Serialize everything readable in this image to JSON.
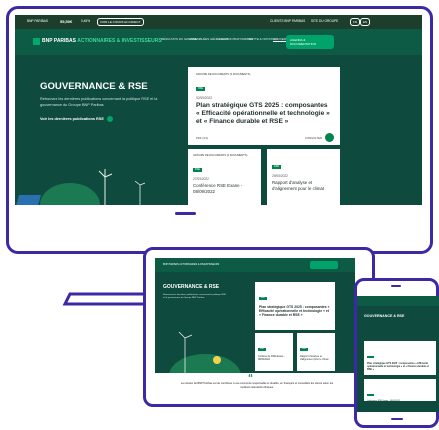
{
  "colors": {
    "frame": "#3b2aa3",
    "screen_bg": "#0e4a3d",
    "nav_bg": "#0d5a45",
    "accent_green": "#00a36a",
    "badge_green": "#00844f"
  },
  "desktop": {
    "top_strip": {
      "market_label": "BNP PARIBAS",
      "price": "55,50€",
      "change": "0,48%",
      "strip_link": "VOIR LE COURS EN DIRECT",
      "right_links": [
        "CLIENTS BNP PARIBAS",
        "SITE DU GROUPE",
        "FR",
        "EN"
      ]
    },
    "navbar": {
      "brand": "BNP PARIBAS",
      "brand_accent": "ACTIONNAIRES & INVESTISSEURS",
      "items": [
        "RÉSULTATS DU GROUPE",
        "ASSEMBLÉES GÉNÉRALES",
        "L'ACTION BNP PARIBAS",
        "DETTE & NOTATION",
        "GOUVERNANCE & RSE"
      ],
      "cta": "AGENDA & DOCUMENTATION"
    },
    "hero": {
      "title": "GOUVERNANCE & RSE",
      "description": "Retrouvez les dernières publications concernant la politique RSE et la gouvernance du Groupe BNP Paribas",
      "link": "Voir les dernières publications RSE"
    },
    "main_card": {
      "group": "GROUPE DE DOCUMENTS (3 DOCUMENTS)",
      "badge": "RSE",
      "date": "02/05/2023",
      "title": "Plan stratégique GTS 2025 : composantes « Efficacité opérationnelle et technologie » et « Finance durable et RSE »",
      "footer": "PDF (3.0)",
      "cta": "CONSULTER"
    },
    "card_small_1": {
      "group": "GROUPE DE DOCUMENTS (2 DOCUMENTS)",
      "badge": "RSE",
      "date": "27/09/2022",
      "title": "Conférence RSE Exane - 08/09/2022"
    },
    "card_small_2": {
      "badge": "RSE",
      "date": "29/05/2022",
      "title": "Rapport d'analyse et d'alignement pour le climat"
    }
  },
  "tablet": {
    "brand": "BNP PARIBAS ACTIONNAIRES & INVESTISSEURS",
    "hero_title": "GOUVERNANCE & RSE",
    "description": "Retrouvez les dernières publications concernant la politique RSE et la gouvernance du Groupe BNP Paribas",
    "main_title": "Plan stratégique GTS 2025 : composantes « Efficacité opérationnelle et technologie » et « Finance durable et RSE »",
    "small1": "Conférence RSE Exane - 08/09/2022",
    "small2": "Rapport d'analyse et d'alignement pour le climat",
    "quote_mark": "“",
    "quote": "La mission de BNP Paribas est de contribuer à une économie responsable et durable, en finançant et conseillant les clients selon les meilleurs standards éthiques."
  },
  "phone": {
    "hero_title": "GOUVERNANCE & RSE",
    "card_title": "Plan stratégique GTS 2025 : composantes « Efficacité opérationnelle et technologie » et « Finance durable et RSE »",
    "card2_title": "Conférence RSE Exane - 08/09/2022"
  }
}
